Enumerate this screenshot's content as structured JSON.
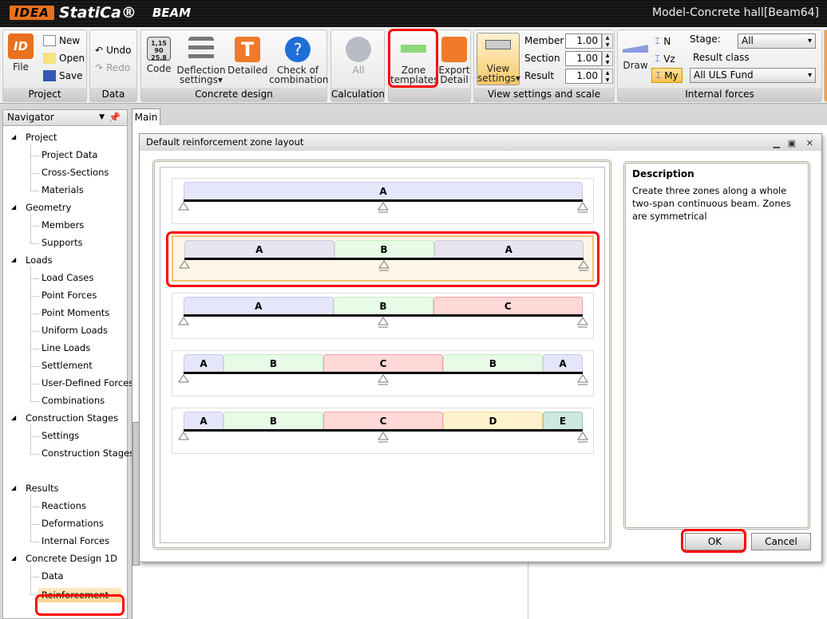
{
  "app": {
    "logo_idea": "IDEA",
    "logo_statica": "StatiCa®",
    "product": "BEAM",
    "window_title": "Model-Concrete hall[Beam64]"
  },
  "ribbon": {
    "project": {
      "label": "Project",
      "file": "File",
      "new": "New",
      "open": "Open",
      "save": "Save"
    },
    "data": {
      "label": "Data",
      "undo": "Undo",
      "redo": "Redo"
    },
    "concrete": {
      "label": "Concrete design",
      "code": "Code",
      "code_icon_text": "1,15 90 25.8",
      "deflection": "Deflection",
      "deflection2": "settings",
      "detailed": "Detailed",
      "check1": "Check of",
      "check2": "combination"
    },
    "calculation": {
      "label": "Calculation",
      "all": "All"
    },
    "zones": {
      "zone1": "Zone",
      "zone2": "templates",
      "export1": "Export",
      "export2": "Detail"
    },
    "view": {
      "label": "View settings and scale",
      "view1": "View",
      "view2": "settings",
      "member": "Member",
      "member_val": "1.00",
      "section": "Section",
      "section_val": "1.00",
      "result": "Result",
      "result_val": "1.00"
    },
    "forces": {
      "label": "Internal forces",
      "draw": "Draw",
      "n": "N",
      "vz": "Vz",
      "my": "My",
      "stage_label": "Stage:",
      "stage_val": "All",
      "result_class_label": "Result class",
      "result_class_val": "All ULS Fund"
    }
  },
  "navigator": {
    "title": "Navigator",
    "groups": [
      {
        "label": "Project",
        "items": [
          "Project Data",
          "Cross-Sections",
          "Materials"
        ]
      },
      {
        "label": "Geometry",
        "items": [
          "Members",
          "Supports"
        ]
      },
      {
        "label": "Loads",
        "items": [
          "Load Cases",
          "Point Forces",
          "Point Moments",
          "Uniform Loads",
          "Line Loads",
          "Settlement",
          "User-Defined Forces",
          "Combinations"
        ]
      },
      {
        "label": "Construction Stages",
        "items": [
          "Settings",
          "Construction Stages"
        ]
      },
      {
        "label": "Results",
        "items": [
          "Reactions",
          "Deformations",
          "Internal Forces"
        ]
      },
      {
        "label": "Concrete Design 1D",
        "items": [
          "Data",
          "Reinforcement"
        ]
      }
    ],
    "selected": "Reinforcement"
  },
  "main_tab": "Main",
  "dialog": {
    "title": "Default reinforcement zone layout",
    "templates": [
      {
        "zones": [
          {
            "l": "A",
            "s": 0,
            "e": 1,
            "c": "blue"
          }
        ]
      },
      {
        "zones": [
          {
            "l": "A",
            "s": 0,
            "e": 0.375,
            "c": "grey"
          },
          {
            "l": "B",
            "s": 0.375,
            "e": 0.625,
            "c": "green"
          },
          {
            "l": "A",
            "s": 0.625,
            "e": 1,
            "c": "grey"
          }
        ],
        "selected": true
      },
      {
        "zones": [
          {
            "l": "A",
            "s": 0,
            "e": 0.375,
            "c": "blue"
          },
          {
            "l": "B",
            "s": 0.375,
            "e": 0.625,
            "c": "green"
          },
          {
            "l": "C",
            "s": 0.625,
            "e": 1,
            "c": "red"
          }
        ]
      },
      {
        "zones": [
          {
            "l": "A",
            "s": 0,
            "e": 0.1,
            "c": "blue"
          },
          {
            "l": "B",
            "s": 0.1,
            "e": 0.35,
            "c": "green"
          },
          {
            "l": "C",
            "s": 0.35,
            "e": 0.65,
            "c": "red"
          },
          {
            "l": "B",
            "s": 0.65,
            "e": 0.9,
            "c": "green"
          },
          {
            "l": "A",
            "s": 0.9,
            "e": 1,
            "c": "blue"
          }
        ]
      },
      {
        "zones": [
          {
            "l": "A",
            "s": 0,
            "e": 0.1,
            "c": "blue"
          },
          {
            "l": "B",
            "s": 0.1,
            "e": 0.35,
            "c": "green"
          },
          {
            "l": "C",
            "s": 0.35,
            "e": 0.65,
            "c": "red"
          },
          {
            "l": "D",
            "s": 0.65,
            "e": 0.9,
            "c": "yellow"
          },
          {
            "l": "E",
            "s": 0.9,
            "e": 1,
            "c": "teal"
          }
        ]
      }
    ],
    "description_title": "Description",
    "description": "Create three zones along a whole two-span continuous beam. Zones are symmetrical",
    "ok": "OK",
    "cancel": "Cancel"
  },
  "colors": {
    "blue": [
      "#e6e6fa",
      "#c8c8f0"
    ],
    "grey": [
      "#e8e4f0",
      "#ccc8e0"
    ],
    "green": [
      "#e8fbe6",
      "#c4ecc0"
    ],
    "red": [
      "#ffd8d8",
      "#f0a0a0"
    ],
    "yellow": [
      "#fff1cc",
      "#f4d88a"
    ],
    "teal": [
      "#cde8dd",
      "#8fcab3"
    ],
    "highlight": "#ff0000",
    "accent": "#e8711c"
  }
}
